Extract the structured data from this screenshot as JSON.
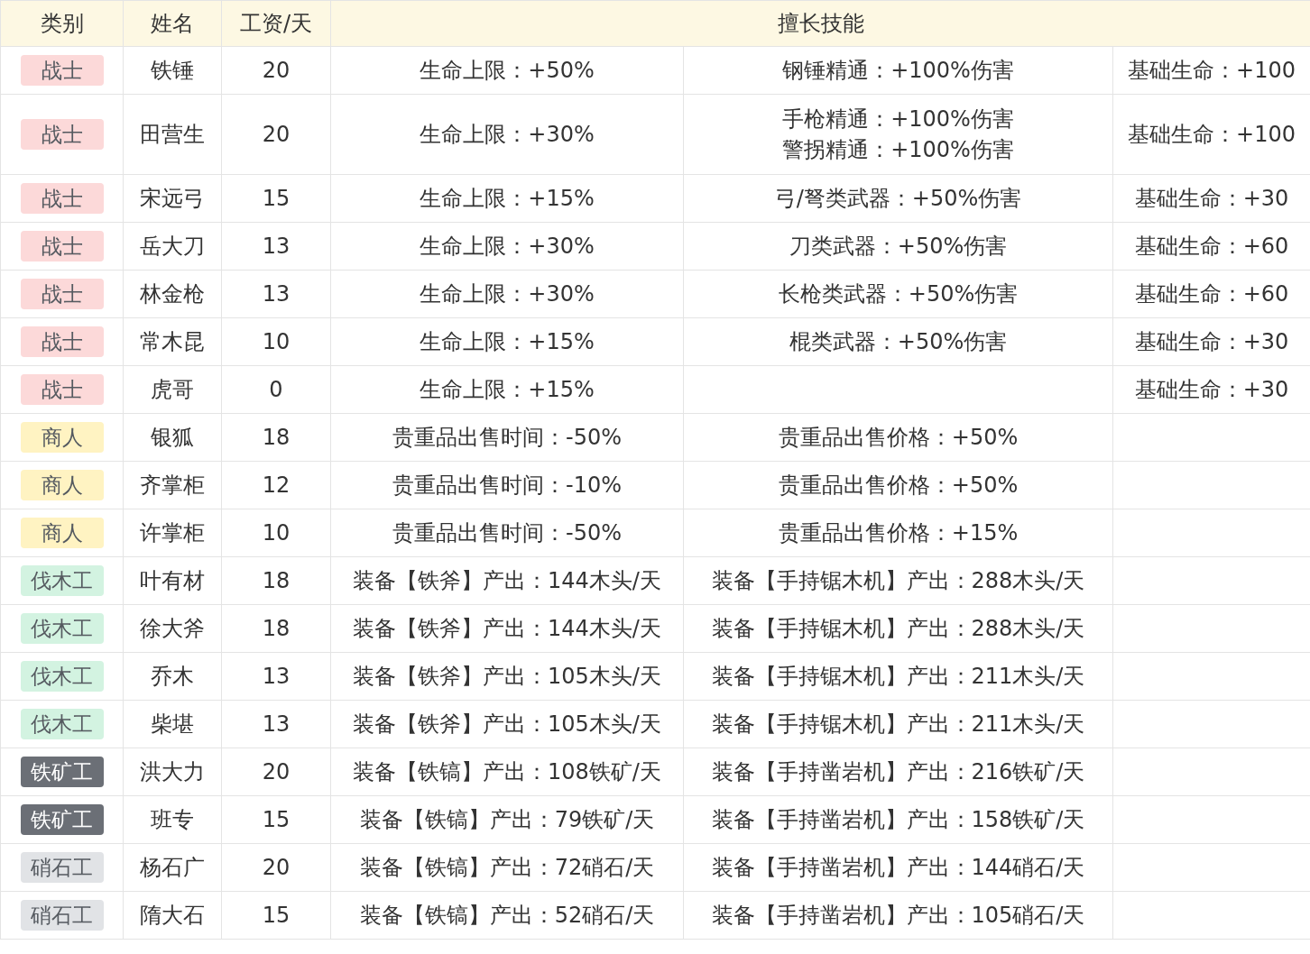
{
  "table": {
    "columns": [
      "类别",
      "姓名",
      "工资/天",
      "擅长技能"
    ],
    "rows": [
      {
        "category": "战士",
        "color": "#fcd9d9",
        "name": "铁锤",
        "wage": "20",
        "skill_1": [
          "生命上限：+50%"
        ],
        "skill_2": [
          "钢锤精通：+100%伤害"
        ],
        "skill_3": [
          "基础生命：+100"
        ]
      },
      {
        "category": "战士",
        "color": "#fcd9d9",
        "name": "田营生",
        "wage": "20",
        "skill_1": [
          "生命上限：+30%"
        ],
        "skill_2": [
          "手枪精通：+100%伤害",
          "警拐精通：+100%伤害"
        ],
        "skill_3": [
          "基础生命：+100"
        ]
      },
      {
        "category": "战士",
        "color": "#fcd9d9",
        "name": "宋远弓",
        "wage": "15",
        "skill_1": [
          "生命上限：+15%"
        ],
        "skill_2": [
          "弓/弩类武器：+50%伤害"
        ],
        "skill_3": [
          "基础生命：+30"
        ]
      },
      {
        "category": "战士",
        "color": "#fcd9d9",
        "name": "岳大刀",
        "wage": "13",
        "skill_1": [
          "生命上限：+30%"
        ],
        "skill_2": [
          "刀类武器：+50%伤害"
        ],
        "skill_3": [
          "基础生命：+60"
        ]
      },
      {
        "category": "战士",
        "color": "#fcd9d9",
        "name": "林金枪",
        "wage": "13",
        "skill_1": [
          "生命上限：+30%"
        ],
        "skill_2": [
          "长枪类武器：+50%伤害"
        ],
        "skill_3": [
          "基础生命：+60"
        ]
      },
      {
        "category": "战士",
        "color": "#fcd9d9",
        "name": "常木昆",
        "wage": "10",
        "skill_1": [
          "生命上限：+15%"
        ],
        "skill_2": [
          "棍类武器：+50%伤害"
        ],
        "skill_3": [
          "基础生命：+30"
        ]
      },
      {
        "category": "战士",
        "color": "#fcd9d9",
        "name": "虎哥",
        "wage": "0",
        "skill_1": [
          "生命上限：+15%"
        ],
        "skill_3": [
          "基础生命：+30"
        ]
      },
      {
        "category": "商人",
        "color": "#fff3c2",
        "name": "银狐",
        "wage": "18",
        "skill_1": [
          "贵重品出售时间：-50%"
        ],
        "skill_2": [
          "贵重品出售价格：+50%"
        ]
      },
      {
        "category": "商人",
        "color": "#fff3c2",
        "name": "齐掌柜",
        "wage": "12",
        "skill_1": [
          "贵重品出售时间：-10%"
        ],
        "skill_2": [
          "贵重品出售价格：+50%"
        ]
      },
      {
        "category": "商人",
        "color": "#fff3c2",
        "name": "许掌柜",
        "wage": "10",
        "skill_1": [
          "贵重品出售时间：-50%"
        ],
        "skill_2": [
          "贵重品出售价格：+15%"
        ]
      },
      {
        "category": "伐木工",
        "color": "#d3f3e1",
        "name": "叶有材",
        "wage": "18",
        "skill_1": [
          "装备【铁斧】产出：144木头/天"
        ],
        "skill_2": [
          "装备【手持锯木机】产出：288木头/天"
        ]
      },
      {
        "category": "伐木工",
        "color": "#d3f3e1",
        "name": "徐大斧",
        "wage": "18",
        "skill_1": [
          "装备【铁斧】产出：144木头/天"
        ],
        "skill_2": [
          "装备【手持锯木机】产出：288木头/天"
        ]
      },
      {
        "category": "伐木工",
        "color": "#d3f3e1",
        "name": "乔木",
        "wage": "13",
        "skill_1": [
          "装备【铁斧】产出：105木头/天"
        ],
        "skill_2": [
          "装备【手持锯木机】产出：211木头/天"
        ]
      },
      {
        "category": "伐木工",
        "color": "#d3f3e1",
        "name": "柴堪",
        "wage": "13",
        "skill_1": [
          "装备【铁斧】产出：105木头/天"
        ],
        "skill_2": [
          "装备【手持锯木机】产出：211木头/天"
        ]
      },
      {
        "category": "铁矿工",
        "color": "#6b6f76",
        "name": "洪大力",
        "wage": "20",
        "skill_1": [
          "装备【铁镐】产出：108铁矿/天"
        ],
        "skill_2": [
          "装备【手持凿岩机】产出：216铁矿/天"
        ]
      },
      {
        "category": "铁矿工",
        "color": "#6b6f76",
        "name": "班专",
        "wage": "15",
        "skill_1": [
          "装备【铁镐】产出：79铁矿/天"
        ],
        "skill_2": [
          "装备【手持凿岩机】产出：158铁矿/天"
        ]
      },
      {
        "category": "硝石工",
        "color": "#e1e3e6",
        "name": "杨石广",
        "wage": "20",
        "skill_1": [
          "装备【铁镐】产出：72硝石/天"
        ],
        "skill_2": [
          "装备【手持凿岩机】产出：144硝石/天"
        ]
      },
      {
        "category": "硝石工",
        "color": "#e1e3e6",
        "name": "隋大石",
        "wage": "15",
        "skill_1": [
          "装备【铁镐】产出：52硝石/天"
        ],
        "skill_2": [
          "装备【手持凿岩机】产出：105硝石/天"
        ]
      }
    ]
  }
}
